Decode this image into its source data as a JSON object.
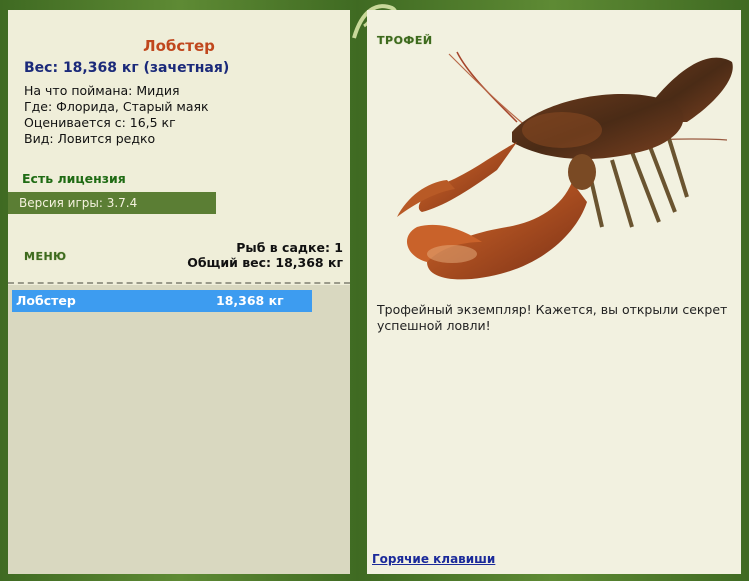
{
  "fish": {
    "name": "Лобстер",
    "weight_line": "Вес: 18,368 кг (зачетная)",
    "bait_line": "На что поймана: Мидия",
    "location_line": "Где: Флорида, Старый маяк",
    "valued_line": "Оценивается с: 16,5 кг",
    "kind_line": "Вид: Ловится редко"
  },
  "license_label": "Есть лицензия",
  "version_label": "Версия игры: 3.7.4",
  "menu_label": "МЕНЮ",
  "keep": {
    "count_line": "Рыб в садке: 1",
    "total_line": "Общий вес: 18,368 кг",
    "rows": [
      {
        "name": "Лобстер",
        "weight": "18,368 кг"
      }
    ]
  },
  "trophy": {
    "label": "ТРОФЕЙ",
    "message": "Трофейный экземпляр! Кажется, вы открыли секрет успешной ловли!"
  },
  "hotkeys_label": "Горячие клавиши",
  "colors": {
    "frame": "#4e7a2c",
    "panel_bg": "#efeed9",
    "selected_row": "#3d9cf0",
    "fish_name": "#c0471d",
    "weight_text": "#1b2a7a"
  }
}
